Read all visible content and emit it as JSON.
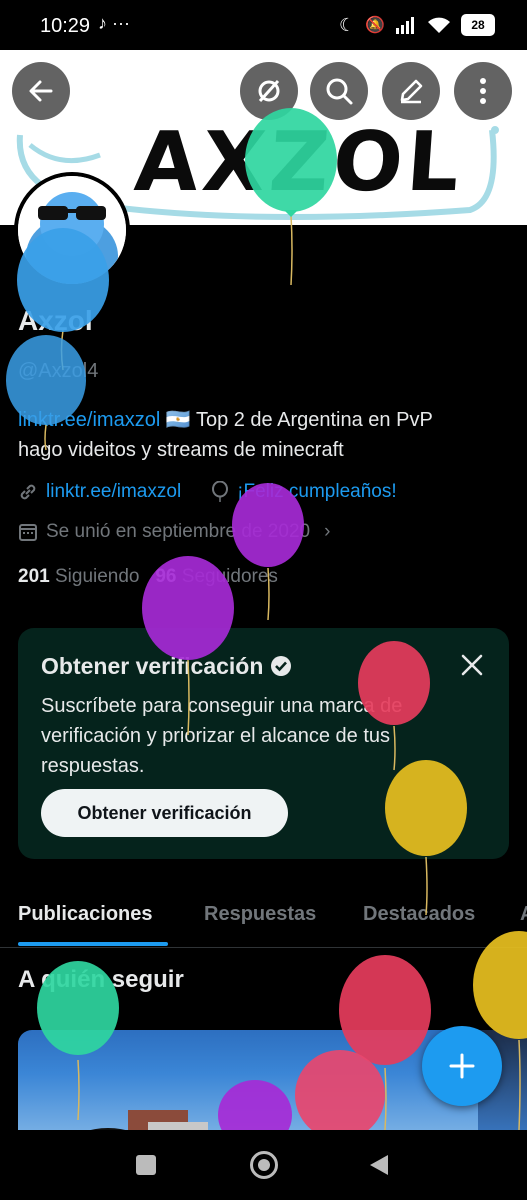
{
  "status_bar": {
    "time": "10:29",
    "notif_icons": "♪ ···",
    "battery": "28"
  },
  "banner": {
    "title": "AXZOL"
  },
  "profile": {
    "name": "Axzol",
    "handle": "@Axzol4",
    "bio_link": "linktr.ee/imaxzol",
    "bio_flag": "🇦🇷",
    "bio_text1": "Top 2 de Argentina en PvP",
    "bio_text2": "hago videitos y streams de minecraft",
    "website": "linktr.ee/imaxzol",
    "birthday": "¡Feliz cumpleaños!",
    "joined": "Se unió en septiembre de 2020",
    "following_count": "201",
    "following_label": "Siguiendo",
    "followers_count": "96",
    "followers_label": "Seguidores"
  },
  "verification_card": {
    "title": "Obtener verificación",
    "text": "Suscríbete para conseguir una marca de verificación y priorizar el alcance de tus respuestas.",
    "button": "Obtener verificación"
  },
  "tabs": [
    "Publicaciones",
    "Respuestas",
    "Destacados",
    "A"
  ],
  "section": {
    "title": "A quién seguir"
  },
  "colors": {
    "accent": "#1d9bf0",
    "card_bg": "#05231c",
    "muted": "#71767b"
  },
  "icons": {
    "back": "back-arrow-icon",
    "hide": "eye-slash-icon",
    "search": "search-icon",
    "edit": "pencil-icon",
    "more": "more-vertical-icon",
    "link": "link-icon",
    "birthday": "balloon-icon",
    "calendar": "calendar-icon",
    "verified": "verified-badge-icon",
    "close": "close-icon",
    "compose": "plus-icon"
  }
}
